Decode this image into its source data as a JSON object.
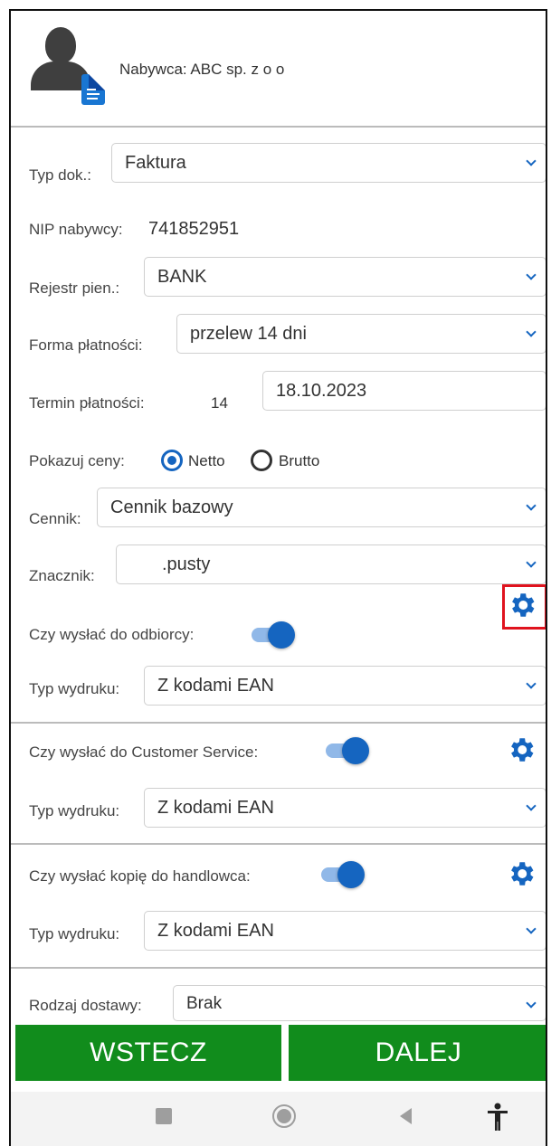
{
  "header": {
    "buyer_label": "Nabywca: ABC sp. z o o",
    "icons": [
      "user-avatar-icon",
      "document-icon"
    ]
  },
  "form": {
    "doc_type": {
      "label": "Typ dok.:",
      "value": "Faktura"
    },
    "nip": {
      "label": "NIP nabywcy:",
      "value": "741852951"
    },
    "register": {
      "label": "Rejestr pien.:",
      "value": "BANK"
    },
    "payment_form": {
      "label": "Forma płatności:",
      "value": "przelew 14 dni"
    },
    "payment_term": {
      "label": "Termin płatności:",
      "days": "14",
      "date": "18.10.2023"
    },
    "show_prices": {
      "label": "Pokazuj ceny:",
      "options": [
        "Netto",
        "Brutto"
      ],
      "selected": "Netto"
    },
    "price_list": {
      "label": "Cennik:",
      "value": "Cennik bazowy"
    },
    "marker": {
      "label": "Znacznik:",
      "value": ".pusty"
    }
  },
  "sections": [
    {
      "send_label": "Czy wysłać do odbiorcy:",
      "send_on": true,
      "print_label": "Typ wydruku:",
      "print_value": "Z kodami EAN",
      "gear_highlighted": true
    },
    {
      "send_label": "Czy wysłać do Customer Service:",
      "send_on": true,
      "print_label": "Typ wydruku:",
      "print_value": "Z kodami EAN",
      "gear_highlighted": false
    },
    {
      "send_label": "Czy wysłać kopię do handlowca:",
      "send_on": true,
      "print_label": "Typ wydruku:",
      "print_value": "Z kodami EAN",
      "gear_highlighted": false
    }
  ],
  "delivery": {
    "label": "Rodzaj dostawy:",
    "value": "Brak"
  },
  "buttons": {
    "back": "WSTECZ",
    "next": "DALEJ"
  },
  "colors": {
    "accent": "#1565c0",
    "button_green": "#118c1c",
    "highlight": "#e0131e"
  }
}
